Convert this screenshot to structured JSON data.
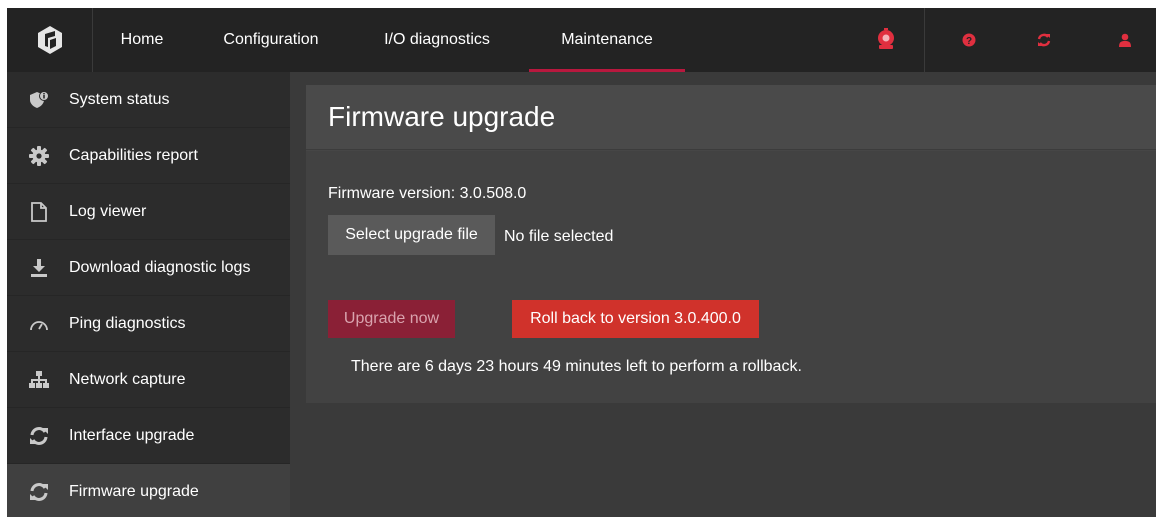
{
  "colors": {
    "accent": "#b8183e",
    "topbar_bg": "#232323",
    "sidebar_bg": "#2c2c2c",
    "content_bg": "#3a3a3a",
    "rollback_button": "#d0322b",
    "upgrade_button_disabled": "#8a2036",
    "icon_red": "#e02f3f"
  },
  "topbar": {
    "logo_icon": "brand-logo-icon",
    "nav": [
      {
        "label": "Home"
      },
      {
        "label": "Configuration"
      },
      {
        "label": "I/O diagnostics"
      },
      {
        "label": "Maintenance",
        "active": true
      }
    ],
    "icons": [
      "alarm-bell-icon",
      "help-icon",
      "refresh-icon",
      "user-icon"
    ]
  },
  "sidebar": {
    "items": [
      {
        "label": "System status",
        "icon": "shield-info-icon"
      },
      {
        "label": "Capabilities report",
        "icon": "gear-icon"
      },
      {
        "label": "Log viewer",
        "icon": "document-icon"
      },
      {
        "label": "Download diagnostic logs",
        "icon": "download-icon"
      },
      {
        "label": "Ping diagnostics",
        "icon": "gauge-icon"
      },
      {
        "label": "Network capture",
        "icon": "network-icon"
      },
      {
        "label": "Interface upgrade",
        "icon": "refresh-icon"
      },
      {
        "label": "Firmware upgrade",
        "icon": "refresh-icon",
        "active": true
      }
    ]
  },
  "main": {
    "title": "Firmware upgrade",
    "firmware_version_label": "Firmware version: 3.0.508.0",
    "select_file_label": "Select upgrade file",
    "file_status": "No file selected",
    "upgrade_button_label": "Upgrade now",
    "rollback_button_label": "Roll back to version 3.0.400.0",
    "rollback_message": "There are 6 days 23 hours 49 minutes left to perform a rollback."
  }
}
